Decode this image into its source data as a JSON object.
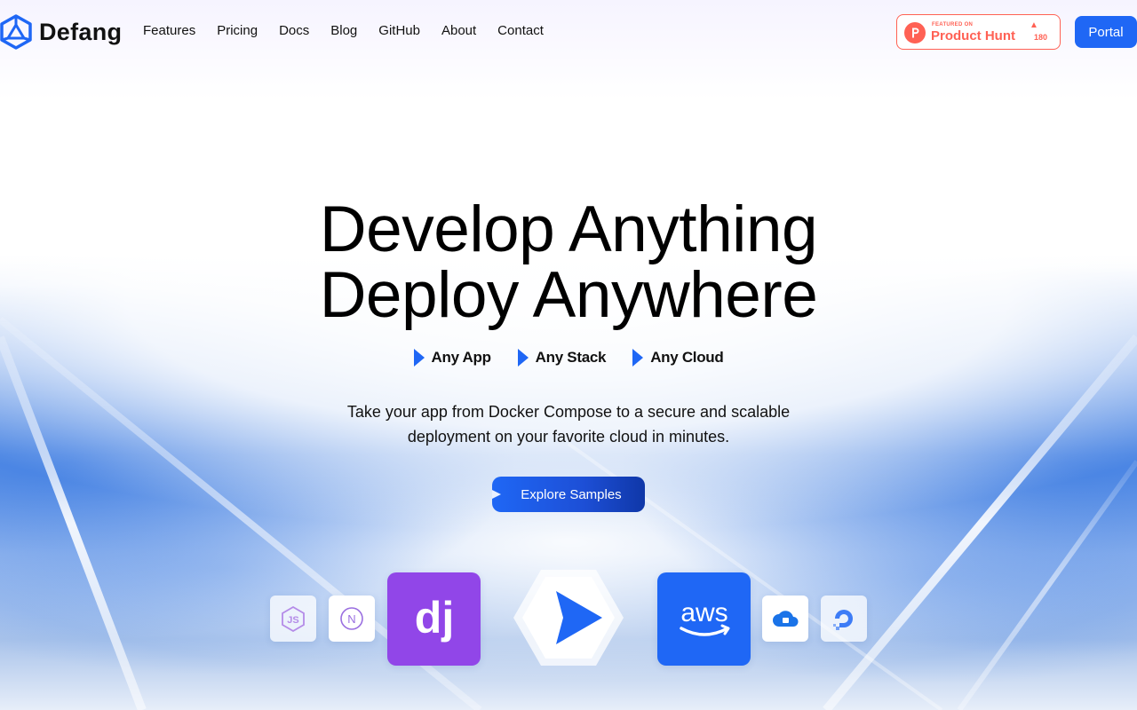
{
  "nav": {
    "brand": "Defang",
    "links": [
      "Features",
      "Pricing",
      "Docs",
      "Blog",
      "GitHub",
      "About",
      "Contact"
    ],
    "product_hunt": {
      "small": "FEATURED ON",
      "name": "Product Hunt",
      "count": "180"
    },
    "portal_label": "Portal"
  },
  "hero": {
    "title_line1": "Develop Anything",
    "title_line2": "Deploy Anywhere",
    "tags": [
      "Any App",
      "Any Stack",
      "Any Cloud"
    ],
    "subtitle_line1": "Take your app from Docker Compose to a secure and scalable",
    "subtitle_line2": "deployment on your favorite cloud in minutes.",
    "cta_label": "Explore Samples"
  },
  "tiles": {
    "js_label": "JS",
    "next_label": "N",
    "django_label": "dj",
    "aws_label": "aws"
  },
  "colors": {
    "accent": "#1f67f5",
    "product_hunt": "#ff6154",
    "django": "#9146e8"
  }
}
